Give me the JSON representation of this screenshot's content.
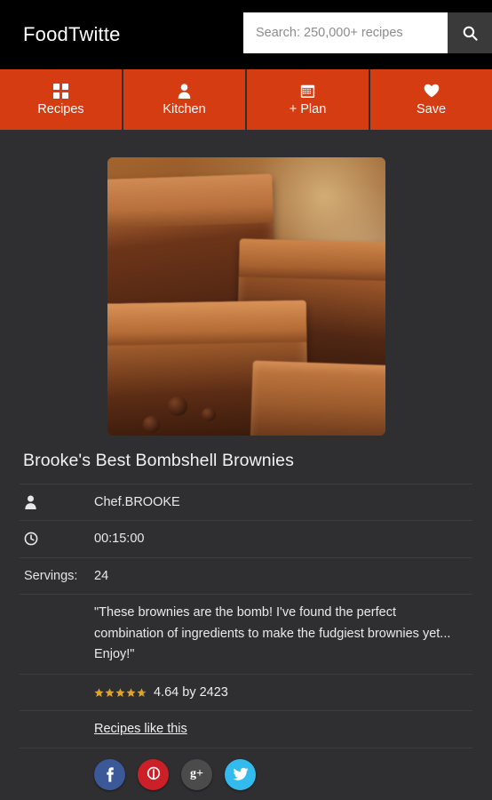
{
  "header": {
    "logo": "FoodTwitte",
    "search": {
      "placeholder": "Search: 250,000+ recipes",
      "value": "",
      "button_icon": "search-icon"
    }
  },
  "nav": {
    "items": [
      {
        "label": "Recipes",
        "icon": "grid-icon"
      },
      {
        "label": "Kitchen",
        "icon": "person-icon"
      },
      {
        "label": "+ Plan",
        "icon": "calendar-icon"
      },
      {
        "label": "Save",
        "icon": "heart-icon"
      }
    ]
  },
  "recipe": {
    "image_alt": "Stacked fudgy chocolate brownies",
    "title": "Brooke's Best Bombshell Brownies",
    "author": {
      "icon": "person-icon",
      "value": "Chef.BROOKE"
    },
    "time": {
      "icon": "clock-icon",
      "value": "00:15:00"
    },
    "servings": {
      "label": "Servings:",
      "value": "24"
    },
    "description": "\"These brownies are the bomb! I've found the perfect combination of ingredients to make the fudgiest brownies yet... Enjoy!\"",
    "rating": {
      "stars": 5,
      "filled": 4.64,
      "text": "4.64 by 2423"
    },
    "similar_link": "Recipes like this"
  },
  "social": {
    "items": [
      {
        "name": "facebook",
        "glyph": "f"
      },
      {
        "name": "pinterest",
        "glyph": "P"
      },
      {
        "name": "googleplus",
        "glyph": "g+"
      },
      {
        "name": "twitter",
        "glyph": "t"
      }
    ]
  },
  "colors": {
    "accent_orange": "#d63c12",
    "header_black": "#000000",
    "page_bg": "#2f2e30",
    "divider": "#3d3c3e",
    "star_gold": "#e0a326"
  }
}
